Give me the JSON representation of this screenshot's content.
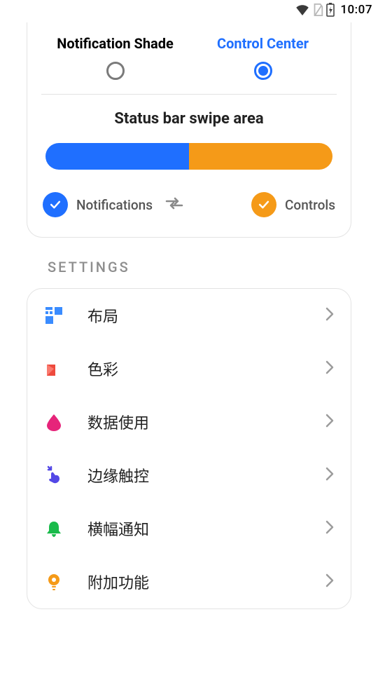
{
  "statusbar": {
    "time": "10:07"
  },
  "top": {
    "option_notification": "Notification Shade",
    "option_control": "Control Center",
    "swipe_title": "Status bar swipe area",
    "legend_notifications": "Notifications",
    "legend_controls": "Controls"
  },
  "section": {
    "title": "SETTINGS"
  },
  "rows": {
    "layout": "布局",
    "color": "色彩",
    "data": "数据使用",
    "edge": "边缘触控",
    "banner": "横幅通知",
    "extra": "附加功能"
  }
}
